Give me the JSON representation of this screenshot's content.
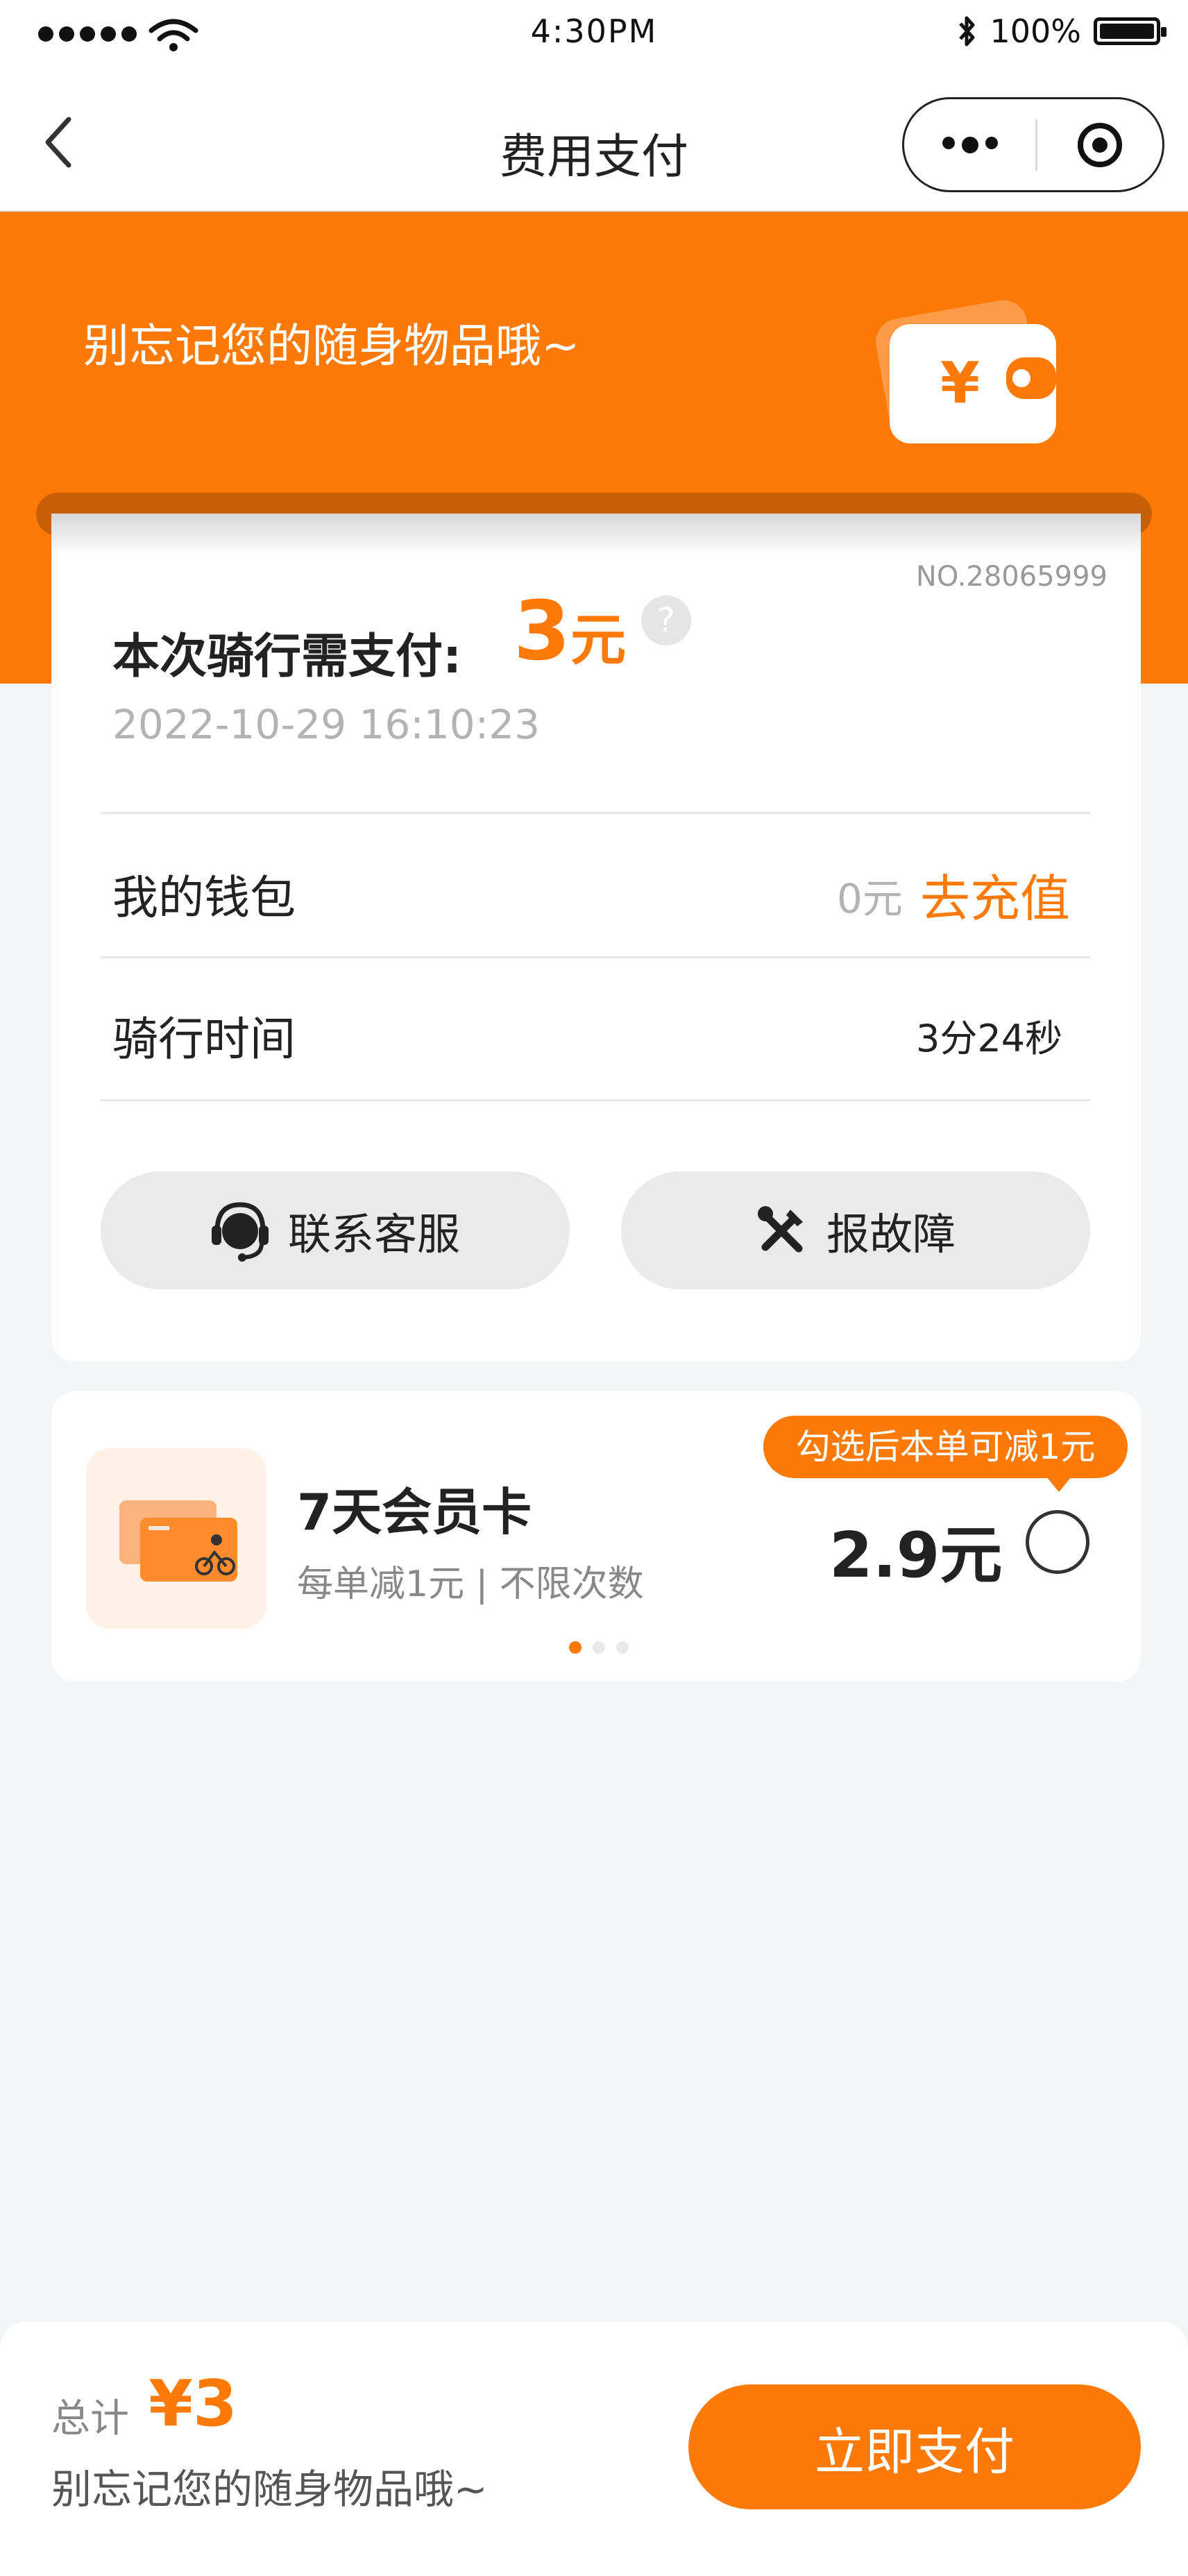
{
  "status_bar": {
    "time": "4:30PM",
    "battery": "100%",
    "signal_icon": "signal-dots-icon",
    "wifi_icon": "wifi-icon",
    "bluetooth_icon": "bluetooth-icon"
  },
  "nav": {
    "title": "费用支付",
    "back_icon": "chevron-left-icon",
    "more_icon": "more-dots-icon",
    "close_icon": "target-icon"
  },
  "banner": {
    "text": "别忘记您的随身物品哦~",
    "wallet_symbol": "¥",
    "color": "#fe7a08"
  },
  "payment": {
    "order_no": "NO.28065999",
    "label": "本次骑行需支付:",
    "amount": "3",
    "unit": "元",
    "help": "?",
    "datetime": "2022-10-29 16:10:23"
  },
  "rows": {
    "wallet_label": "我的钱包",
    "wallet_balance": "0元",
    "topup": "去充值",
    "ride_time_label": "骑行时间",
    "ride_time": "3分24秒"
  },
  "buttons": {
    "service": "联系客服",
    "report": "报故障"
  },
  "membership": {
    "title": "7天会员卡",
    "desc": "每单减1元 | 不限次数",
    "tip": "勾选后本单可减1元",
    "price": "2.9元",
    "carousel_active": 1,
    "carousel_total": 3
  },
  "footer": {
    "total_label": "总计",
    "total_amount": "¥3",
    "hint": "别忘记您的随身物品哦~",
    "pay_button": "立即支付"
  }
}
